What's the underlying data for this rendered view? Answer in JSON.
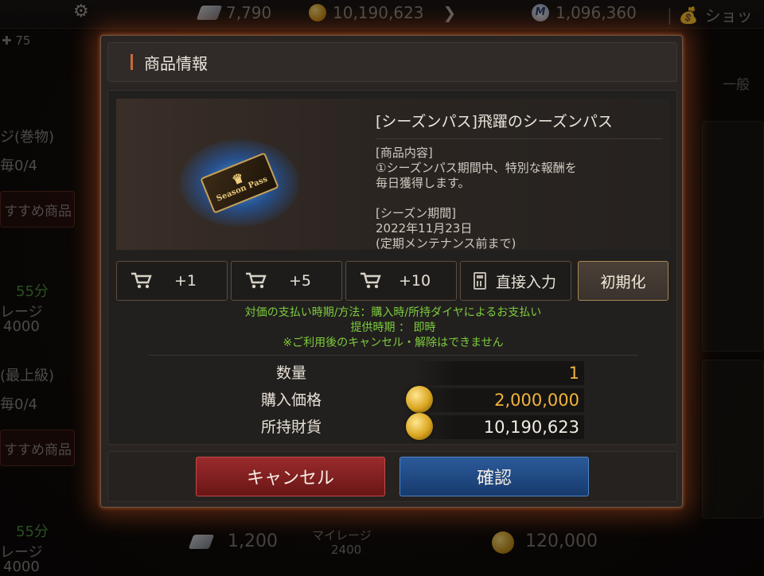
{
  "topbar": {
    "gem_count": "7,790",
    "gold_count": "10,190,623",
    "mileage_icon_letter": "M",
    "mileage_count": "1,096,360",
    "shop_label": "ショッ",
    "level_value": "75"
  },
  "background": {
    "left": {
      "item1_title": "ジ(巻物)",
      "item1_limit": "毎0/4",
      "item1_button": "すすめ商品",
      "item1_timer": "55分",
      "item1_mileage_label": "レージ",
      "item1_mileage_value": "4000",
      "item2_title": "(最上級)",
      "item2_limit": "毎0/4",
      "item2_button": "すすめ商品",
      "item2_timer": "55分",
      "item2_mileage_label": "レージ",
      "item2_mileage_value": "4000"
    },
    "right": {
      "tab_label": "一般"
    },
    "bottom": {
      "gem_price": "1,200",
      "mileage_label": "マイレージ",
      "mileage_value": "2400",
      "gold_price": "120,000"
    }
  },
  "modal": {
    "title": "商品情報",
    "product_name": "[シーズンパス]飛躍のシーズンパス",
    "description": "[商品内容]\n①シーズンパス期間中、特別な報酬を\n毎日獲得します。\n\n[シーズン期間]\n2022年11月23日\n(定期メンテナンス前まで)",
    "ticket_text": "Season Pass",
    "qty_buttons": [
      {
        "label": "+1",
        "icon": "cart-icon"
      },
      {
        "label": "+5",
        "icon": "cart-icon"
      },
      {
        "label": "+10",
        "icon": "cart-icon"
      },
      {
        "label": "直接入力",
        "icon": "calculator-icon"
      }
    ],
    "reset_label": "初期化",
    "notice_lines": [
      "対価の支払い時期/方法：購入時/所持ダイヤによるお支払い",
      "提供時期 ： 即時",
      "※ご利用後のキャンセル・解除はできません"
    ],
    "quantity_label": "数量",
    "quantity_value": "1",
    "price_label": "購入価格",
    "price_value": "2,000,000",
    "owned_label": "所持財貨",
    "owned_value": "10,190,623",
    "cancel_label": "キャンセル",
    "confirm_label": "確認"
  },
  "colors": {
    "notice_green": "#7ecb3e",
    "price_orange": "#f0b43c",
    "cancel_red": "#8a2222",
    "confirm_blue": "#234c86",
    "glow_orange": "#be501e"
  }
}
